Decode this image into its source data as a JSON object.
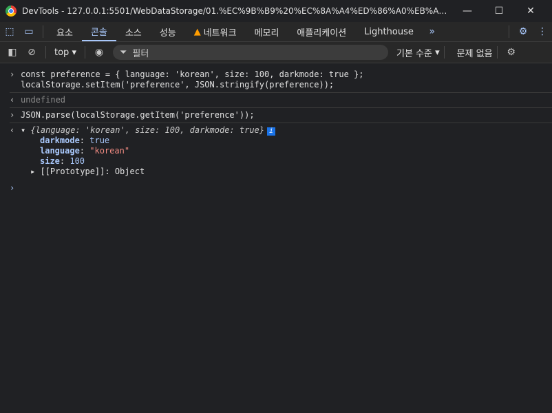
{
  "window": {
    "title": "DevTools - 127.0.0.1:5501/WebDataStorage/01.%EC%9B%B9%20%EC%8A%A4%ED%86%A0%EB%A6%AC%EC%A7%..."
  },
  "tabs": [
    "요소",
    "콘솔",
    "소스",
    "성능",
    "네트워크",
    "메모리",
    "애플리케이션",
    "Lighthouse"
  ],
  "toolbar": {
    "context": "top",
    "filter_placeholder": "필터",
    "level": "기본 수준",
    "issues": "문제 없음"
  },
  "console": {
    "line1_a": "const preference = { language: 'korean', size: 100, darkmode: true };",
    "line1_b": "localStorage.setItem('preference', JSON.stringify(preference));",
    "result1": "undefined",
    "line2": "JSON.parse(localStorage.getItem('preference'));",
    "object_preview": "{language: 'korean', size: 100, darkmode: true}",
    "props": [
      {
        "key": "darkmode",
        "value": "true"
      },
      {
        "key": "language",
        "value": "\"korean\""
      },
      {
        "key": "size",
        "value": "100"
      }
    ],
    "prototype": "[[Prototype]]: Object"
  },
  "colors": {
    "bg": "#202124",
    "accent": "#a8c7fa",
    "warning": "#ff9d00"
  }
}
